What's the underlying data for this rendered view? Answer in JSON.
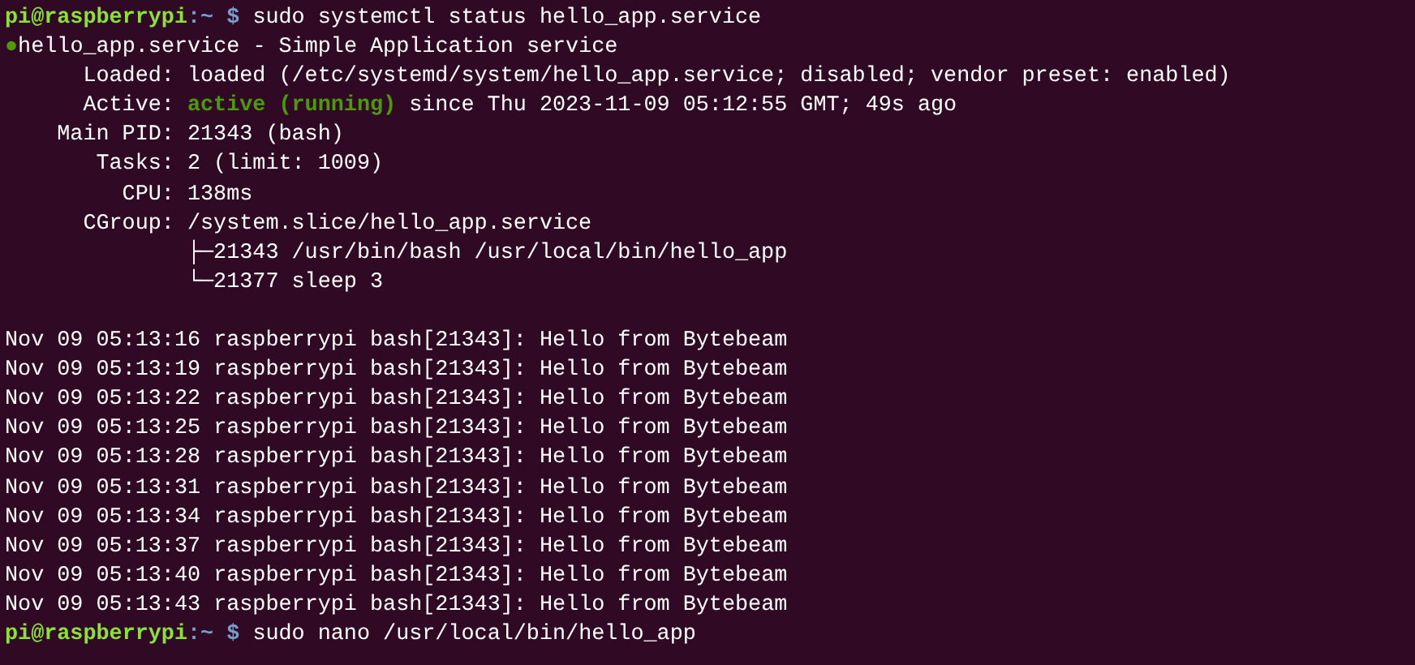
{
  "terminal": {
    "lines": [
      {
        "kind": "prompt",
        "user_host": "pi@raspberrypi",
        "path": ":~",
        "symbol": "$",
        "command": "sudo systemctl status hello_app.service"
      },
      {
        "kind": "unit",
        "dot": "●",
        "color": "#4e9a06",
        "text": "hello_app.service - Simple Application service"
      },
      {
        "kind": "field",
        "label": "Loaded:",
        "value": "loaded (/etc/systemd/system/hello_app.service; disabled; vendor preset: enabled)"
      },
      {
        "kind": "field",
        "label": "Active:",
        "state": "active (running)",
        "value": "since Thu 2023-11-09 05:12:55 GMT; 49s ago"
      },
      {
        "kind": "field",
        "label": "Main PID:",
        "value": "21343 (bash)"
      },
      {
        "kind": "field",
        "label": "Tasks:",
        "value": "2 (limit: 1009)"
      },
      {
        "kind": "field",
        "label": "CPU:",
        "value": "138ms"
      },
      {
        "kind": "field",
        "label": "CGroup:",
        "value": "/system.slice/hello_app.service"
      },
      {
        "kind": "tree",
        "text": "├─21343 /usr/bin/bash /usr/local/bin/hello_app"
      },
      {
        "kind": "tree",
        "text": "└─21377 sleep 3"
      },
      {
        "kind": "blank"
      },
      {
        "kind": "log",
        "text": "Nov 09 05:13:16 raspberrypi bash[21343]: Hello from Bytebeam"
      },
      {
        "kind": "log",
        "text": "Nov 09 05:13:19 raspberrypi bash[21343]: Hello from Bytebeam"
      },
      {
        "kind": "log",
        "text": "Nov 09 05:13:22 raspberrypi bash[21343]: Hello from Bytebeam"
      },
      {
        "kind": "log",
        "text": "Nov 09 05:13:25 raspberrypi bash[21343]: Hello from Bytebeam"
      },
      {
        "kind": "log",
        "text": "Nov 09 05:13:28 raspberrypi bash[21343]: Hello from Bytebeam"
      },
      {
        "kind": "log",
        "text": "Nov 09 05:13:31 raspberrypi bash[21343]: Hello from Bytebeam"
      },
      {
        "kind": "log",
        "text": "Nov 09 05:13:34 raspberrypi bash[21343]: Hello from Bytebeam"
      },
      {
        "kind": "log",
        "text": "Nov 09 05:13:37 raspberrypi bash[21343]: Hello from Bytebeam"
      },
      {
        "kind": "log",
        "text": "Nov 09 05:13:40 raspberrypi bash[21343]: Hello from Bytebeam"
      },
      {
        "kind": "log",
        "text": "Nov 09 05:13:43 raspberrypi bash[21343]: Hello from Bytebeam"
      },
      {
        "kind": "prompt",
        "user_host": "pi@raspberrypi",
        "path": ":~",
        "symbol": "$",
        "command": "sudo nano /usr/local/bin/hello_app"
      }
    ]
  }
}
